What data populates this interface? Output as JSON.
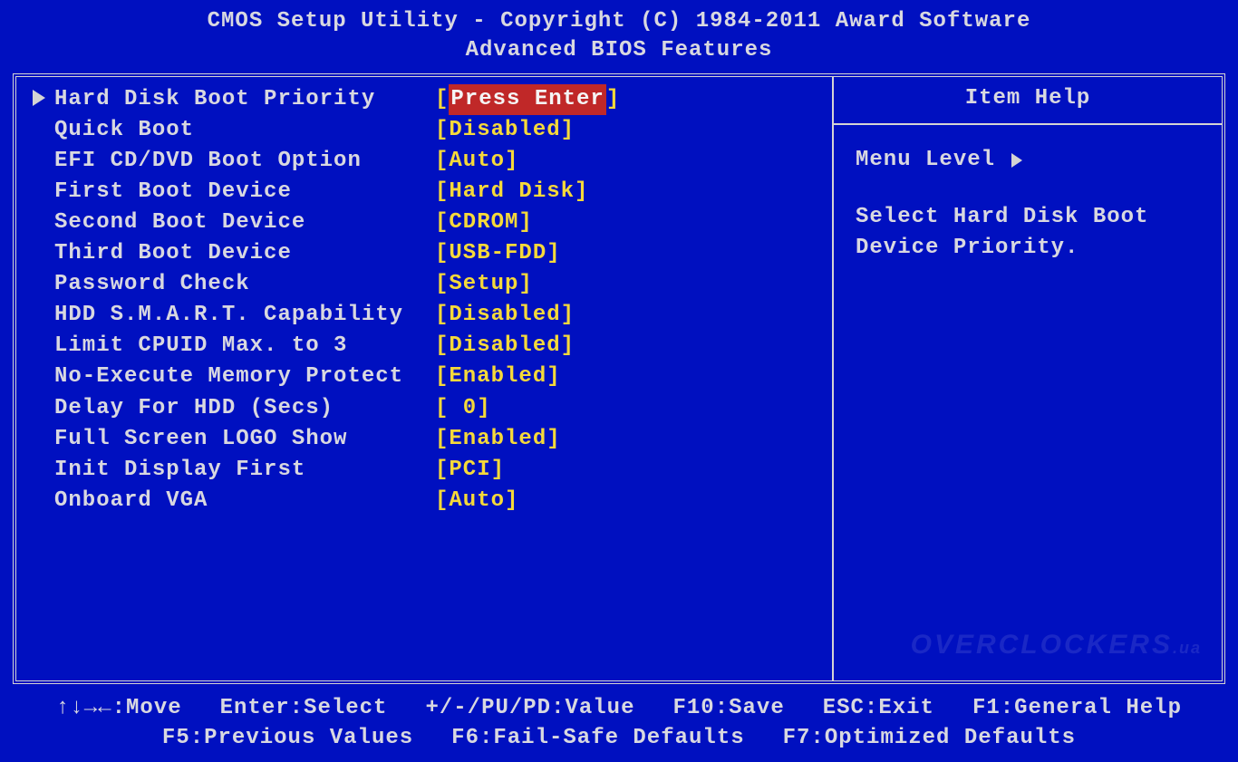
{
  "header": {
    "line1": "CMOS Setup Utility - Copyright (C) 1984-2011 Award Software",
    "line2": "Advanced BIOS Features"
  },
  "settings": [
    {
      "label": "Hard Disk Boot Priority",
      "value": "Press Enter",
      "selected": true
    },
    {
      "label": "Quick Boot",
      "value": "Disabled",
      "selected": false
    },
    {
      "label": "EFI CD/DVD Boot Option",
      "value": "Auto",
      "selected": false
    },
    {
      "label": "First Boot Device",
      "value": "Hard Disk",
      "selected": false
    },
    {
      "label": "Second Boot Device",
      "value": "CDROM",
      "selected": false
    },
    {
      "label": "Third Boot Device",
      "value": "USB-FDD",
      "selected": false
    },
    {
      "label": "Password Check",
      "value": "Setup",
      "selected": false
    },
    {
      "label": "HDD S.M.A.R.T. Capability",
      "value": "Disabled",
      "selected": false
    },
    {
      "label": "Limit CPUID Max. to 3",
      "value": "Disabled",
      "selected": false
    },
    {
      "label": "No-Execute Memory Protect",
      "value": "Enabled",
      "selected": false
    },
    {
      "label": "Delay For HDD (Secs)",
      "value": " 0",
      "selected": false
    },
    {
      "label": "Full Screen LOGO Show",
      "value": "Enabled",
      "selected": false
    },
    {
      "label": "Init Display First",
      "value": "PCI",
      "selected": false
    },
    {
      "label": "Onboard VGA",
      "value": "Auto",
      "selected": false
    }
  ],
  "help": {
    "title": "Item Help",
    "menu_level_label": "Menu Level",
    "text": "Select Hard Disk Boot Device Priority."
  },
  "footer": {
    "line1": {
      "move": "↑↓→←:Move",
      "select": "Enter:Select",
      "value": "+/-/PU/PD:Value",
      "save": "F10:Save",
      "exit": "ESC:Exit",
      "help": "F1:General Help"
    },
    "line2": {
      "prev": "F5:Previous Values",
      "safe": "F6:Fail-Safe Defaults",
      "opt": "F7:Optimized Defaults"
    }
  },
  "watermark": "OVERCLOCKERS",
  "watermark_suffix": ".ua"
}
